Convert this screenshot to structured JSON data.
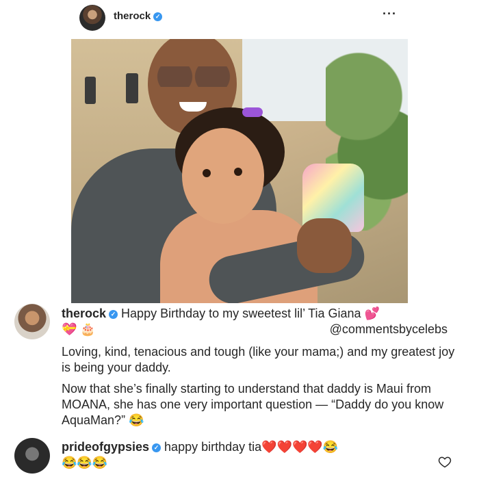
{
  "header": {
    "username": "therock",
    "verified_icon": "check",
    "more_label": "···"
  },
  "post": {
    "comment_user": "therock",
    "caption_line1": "Happy Birthday to my sweetest lil’ Tia Giana 💕",
    "caption_line2": "💝 🎂",
    "watermark": "@commentsbycelebs",
    "para1": "Loving, kind, tenacious and tough (like your mama;) and my greatest joy is being your daddy.",
    "para2": "Now that she’s finally starting to understand that daddy is Maui from MOANA, she has one very important question — “Daddy do you know AquaMan?” 😂"
  },
  "reply": {
    "username": "prideofgypsies",
    "text": "happy birthday tia❤️❤️❤️❤️😂",
    "text_line2": "😂😂😂"
  },
  "icons": {
    "heart": "heart-outline-icon"
  },
  "colors": {
    "verified": "#3897f0",
    "text": "#262626"
  }
}
